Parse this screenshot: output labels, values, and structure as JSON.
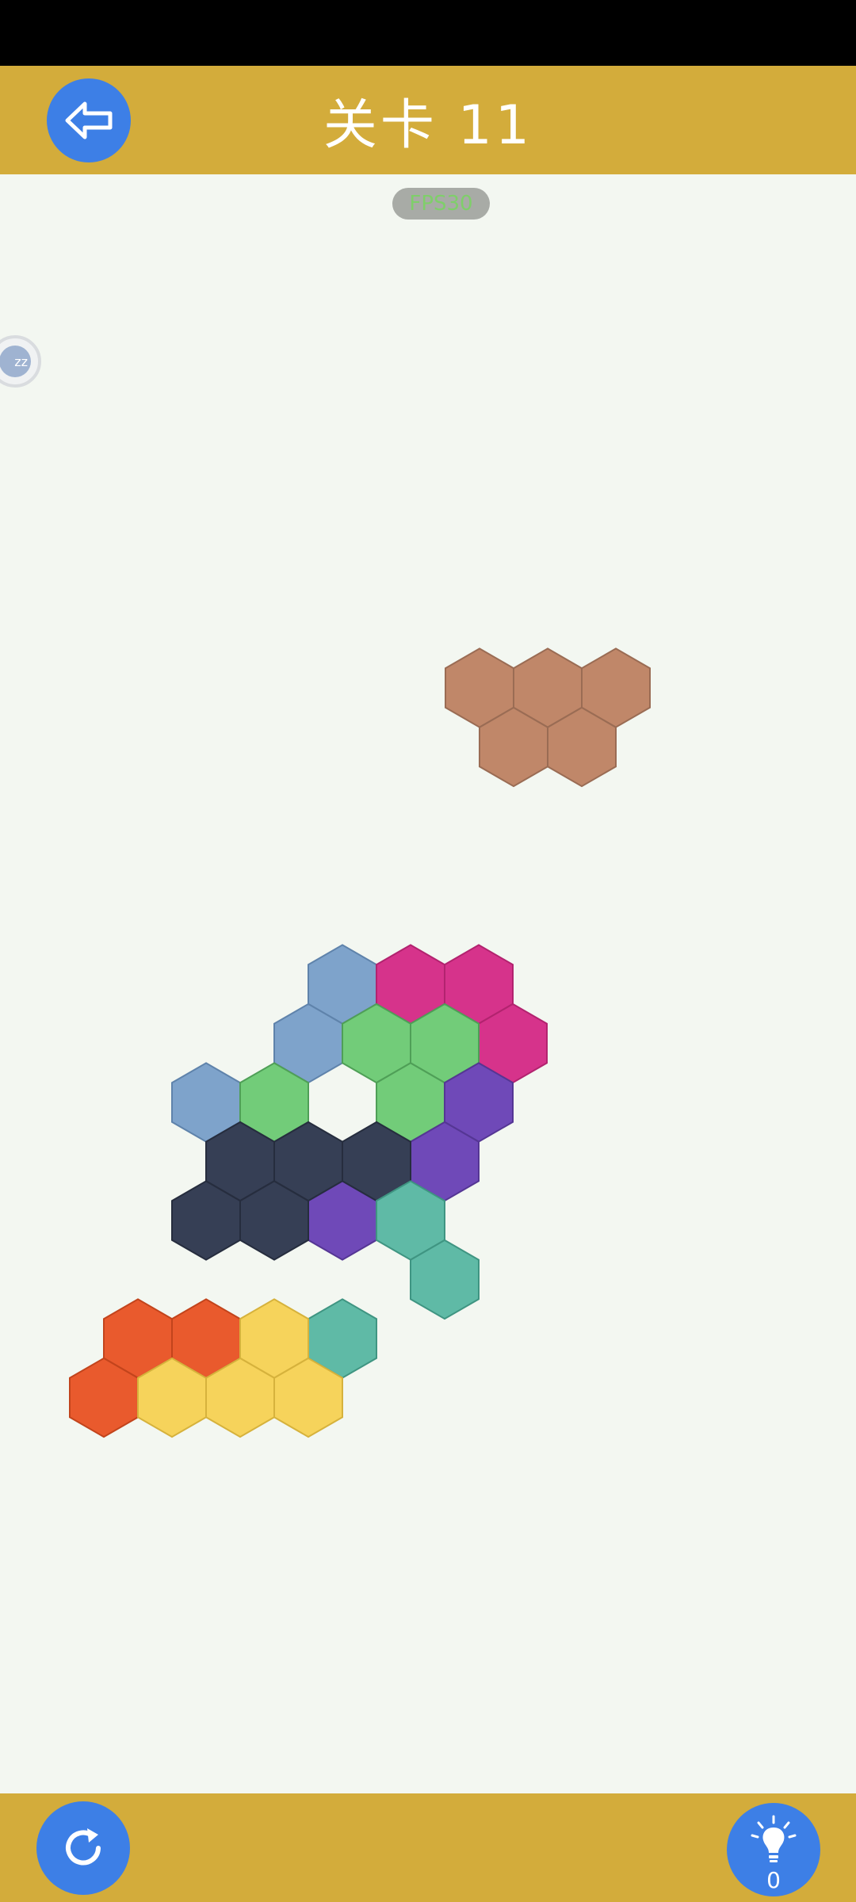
{
  "header": {
    "title": "关卡 11",
    "back_icon": "back-arrow-icon"
  },
  "fps_badge": "FPS30",
  "floating_ball": {
    "label": "zz"
  },
  "footer": {
    "restart_icon": "restart-icon",
    "hint_icon": "lightbulb-icon",
    "hint_count": "0"
  },
  "colors": {
    "bar": "#d3ac3b",
    "button": "#3d7fe6",
    "background": "#f3f7f1"
  },
  "pieces": [
    {
      "name": "loose-brown-piece",
      "color": "#c08769",
      "stroke": "#9a6c54",
      "cells": [
        [
          0,
          0
        ],
        [
          1,
          0
        ],
        [
          2,
          0
        ],
        [
          0,
          1
        ],
        [
          1,
          1
        ]
      ],
      "anchor": "loose"
    },
    {
      "name": "blue-piece",
      "color": "#7ea3cb",
      "stroke": "#5f83ab",
      "cells": [
        [
          0,
          0
        ],
        [
          -1,
          1
        ],
        [
          -2,
          2
        ]
      ],
      "anchor": "board"
    },
    {
      "name": "magenta-piece",
      "color": "#d6338b",
      "stroke": "#b2236f",
      "cells": [
        [
          1,
          0
        ],
        [
          2,
          0
        ],
        [
          2,
          1
        ]
      ],
      "anchor": "board"
    },
    {
      "name": "green-piece",
      "color": "#72cc79",
      "stroke": "#4f9f57",
      "cells": [
        [
          0,
          1
        ],
        [
          1,
          1
        ],
        [
          -1,
          2
        ],
        [
          1,
          2
        ]
      ],
      "anchor": "board"
    },
    {
      "name": "purple-piece",
      "color": "#6f49b8",
      "stroke": "#553694",
      "cells": [
        [
          2,
          2
        ],
        [
          1,
          3
        ],
        [
          0,
          4
        ]
      ],
      "anchor": "board"
    },
    {
      "name": "navy-piece",
      "color": "#363f55",
      "stroke": "#262d3e",
      "cells": [
        [
          -2,
          3
        ],
        [
          -1,
          3
        ],
        [
          0,
          3
        ],
        [
          -2,
          4
        ],
        [
          -1,
          4
        ]
      ],
      "anchor": "board"
    },
    {
      "name": "teal-piece",
      "color": "#5fbaa6",
      "stroke": "#3f9582",
      "cells": [
        [
          1,
          4
        ],
        [
          1,
          5
        ],
        [
          0,
          6
        ]
      ],
      "anchor": "board"
    },
    {
      "name": "orange-piece",
      "color": "#e95a2d",
      "stroke": "#c2441c",
      "cells": [
        [
          -3,
          6
        ],
        [
          -2,
          6
        ],
        [
          -4,
          7
        ]
      ],
      "anchor": "board"
    },
    {
      "name": "yellow-piece",
      "color": "#f6d35b",
      "stroke": "#d6b23c",
      "cells": [
        [
          -1,
          6
        ],
        [
          -3,
          7
        ],
        [
          -2,
          7
        ],
        [
          -1,
          7
        ]
      ],
      "anchor": "board"
    }
  ]
}
